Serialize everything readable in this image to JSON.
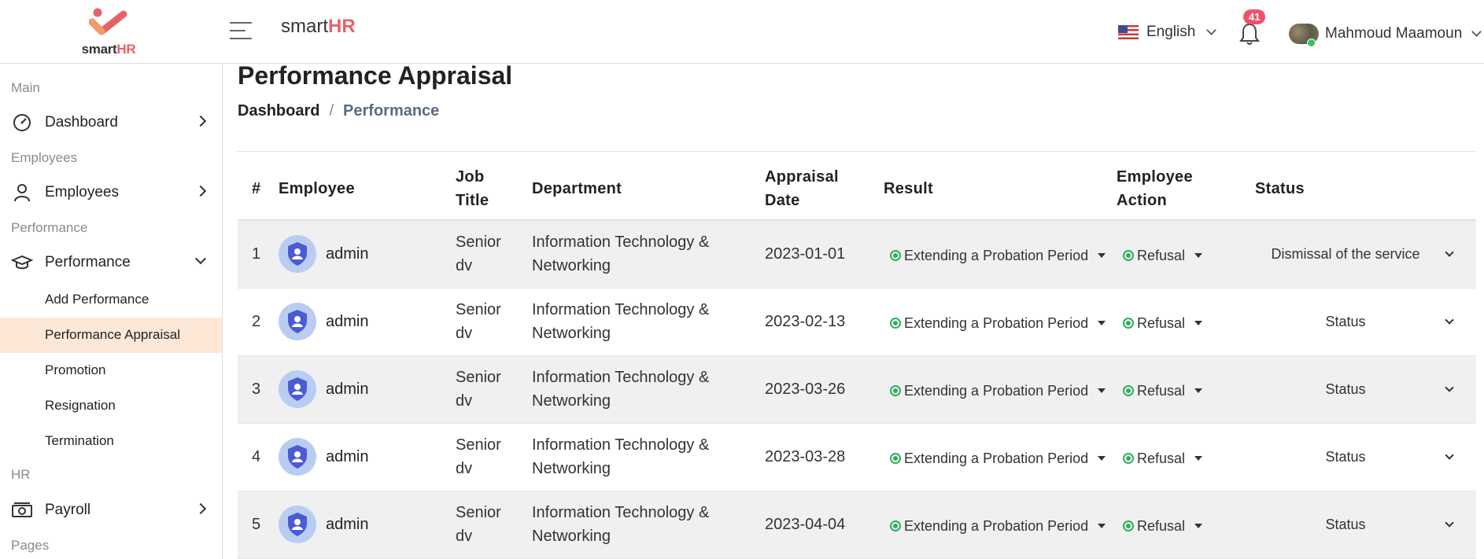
{
  "header": {
    "logo_text": "smart",
    "logo_text_accent": "HR",
    "brand_text": "smart",
    "brand_accent": "HR",
    "language": "English",
    "notification_count": "41",
    "user_name": "Mahmoud Maamoun"
  },
  "sidebar": {
    "sections": {
      "main": "Main",
      "employees": "Employees",
      "performance": "Performance",
      "hr": "HR",
      "pages": "Pages"
    },
    "items": {
      "dashboard": "Dashboard",
      "employees": "Employees",
      "performance": "Performance",
      "payroll": "Payroll"
    },
    "sub_items": [
      {
        "label": "Add Performance"
      },
      {
        "label": "Performance Appraisal"
      },
      {
        "label": "Promotion"
      },
      {
        "label": "Resignation"
      },
      {
        "label": "Termination"
      }
    ]
  },
  "page": {
    "title": "Performance Appraisal",
    "breadcrumb": {
      "home": "Dashboard",
      "separator": "/",
      "current": "Performance"
    }
  },
  "table": {
    "headers": {
      "num": "#",
      "employee": "Employee",
      "job_title_1": "Job",
      "job_title_2": "Title",
      "department": "Department",
      "date_1": "Appraisal",
      "date_2": "Date",
      "result": "Result",
      "action_1": "Employee",
      "action_2": "Action",
      "status": "Status"
    },
    "rows": [
      {
        "num": "1",
        "employee": "admin",
        "job_1": "Senior",
        "job_2": "dv",
        "dept_1": "Information Technology &",
        "dept_2": "Networking",
        "date": "2023-01-01",
        "result": "Extending a Probation Period",
        "action": "Refusal",
        "status": "Dismissal of the service"
      },
      {
        "num": "2",
        "employee": "admin",
        "job_1": "Senior",
        "job_2": "dv",
        "dept_1": "Information Technology &",
        "dept_2": "Networking",
        "date": "2023-02-13",
        "result": "Extending a Probation Period",
        "action": "Refusal",
        "status": "Status"
      },
      {
        "num": "3",
        "employee": "admin",
        "job_1": "Senior",
        "job_2": "dv",
        "dept_1": "Information Technology &",
        "dept_2": "Networking",
        "date": "2023-03-26",
        "result": "Extending a Probation Period",
        "action": "Refusal",
        "status": "Status"
      },
      {
        "num": "4",
        "employee": "admin",
        "job_1": "Senior",
        "job_2": "dv",
        "dept_1": "Information Technology &",
        "dept_2": "Networking",
        "date": "2023-03-28",
        "result": "Extending a Probation Period",
        "action": "Refusal",
        "status": "Status"
      },
      {
        "num": "5",
        "employee": "admin",
        "job_1": "Senior",
        "job_2": "dv",
        "dept_1": "Information Technology &",
        "dept_2": "Networking",
        "date": "2023-04-04",
        "result": "Extending a Probation Period",
        "action": "Refusal",
        "status": "Status"
      }
    ]
  },
  "colors": {
    "accent": "#e8606a",
    "active_bg": "#fde8d8",
    "progress": "#1c4f9c",
    "status_green": "#2fae5b"
  }
}
